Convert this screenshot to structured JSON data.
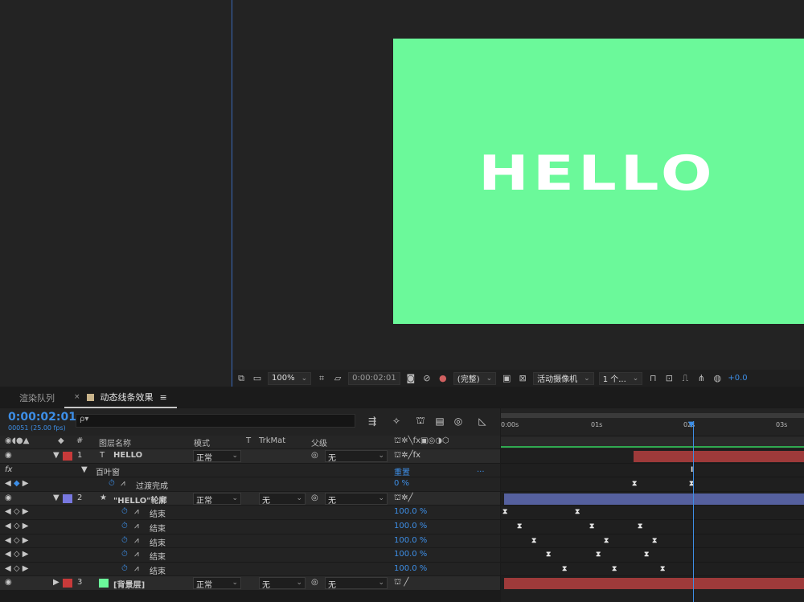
{
  "viewer": {
    "canvas_text": "HELLO",
    "canvas_color": "#6bf99a",
    "toolbar": {
      "zoom": "100%",
      "timecode": "0:00:02:01",
      "resolution": "(完整)",
      "camera": "活动摄像机",
      "views": "1 个...",
      "exposure": "+0.0"
    }
  },
  "tabs": [
    {
      "label": "渲染队列"
    },
    {
      "label": "动态线条效果"
    }
  ],
  "timeline": {
    "timecode": "0:00:02:01",
    "fps": "00051 (25.00 fps)",
    "search_placeholder": "ρ▾",
    "headers": {
      "num": "#",
      "name": "图层名称",
      "mode": "模式",
      "t": "T",
      "trkmat": "TrkMat",
      "parent": "父级"
    },
    "ruler": [
      "0:00s",
      "01s",
      "02s",
      "03s"
    ],
    "rows": [
      {
        "num": "1",
        "type": "T",
        "name": "HELLO",
        "mode": "正常",
        "trkmat": "",
        "parent": "无",
        "color": "#c83a3a"
      },
      {
        "fx": "fx",
        "name": "百叶窗",
        "reset": "重置",
        "dots": "..."
      },
      {
        "name": "过渡完成",
        "value": "0 %"
      },
      {
        "num": "2",
        "type": "★",
        "name": "\"HELLO\"轮廓",
        "mode": "正常",
        "trkmat": "无",
        "parent": "无",
        "color": "#7878e0"
      },
      {
        "name": "结束",
        "value": "100.0 %"
      },
      {
        "name": "结束",
        "value": "100.0 %"
      },
      {
        "name": "结束",
        "value": "100.0 %"
      },
      {
        "name": "结束",
        "value": "100.0 %"
      },
      {
        "name": "结束",
        "value": "100.0 %"
      },
      {
        "num": "3",
        "type": "",
        "name": "[背景层]",
        "mode": "正常",
        "trkmat": "无",
        "parent": "无",
        "color": "#c83a3a"
      }
    ]
  }
}
